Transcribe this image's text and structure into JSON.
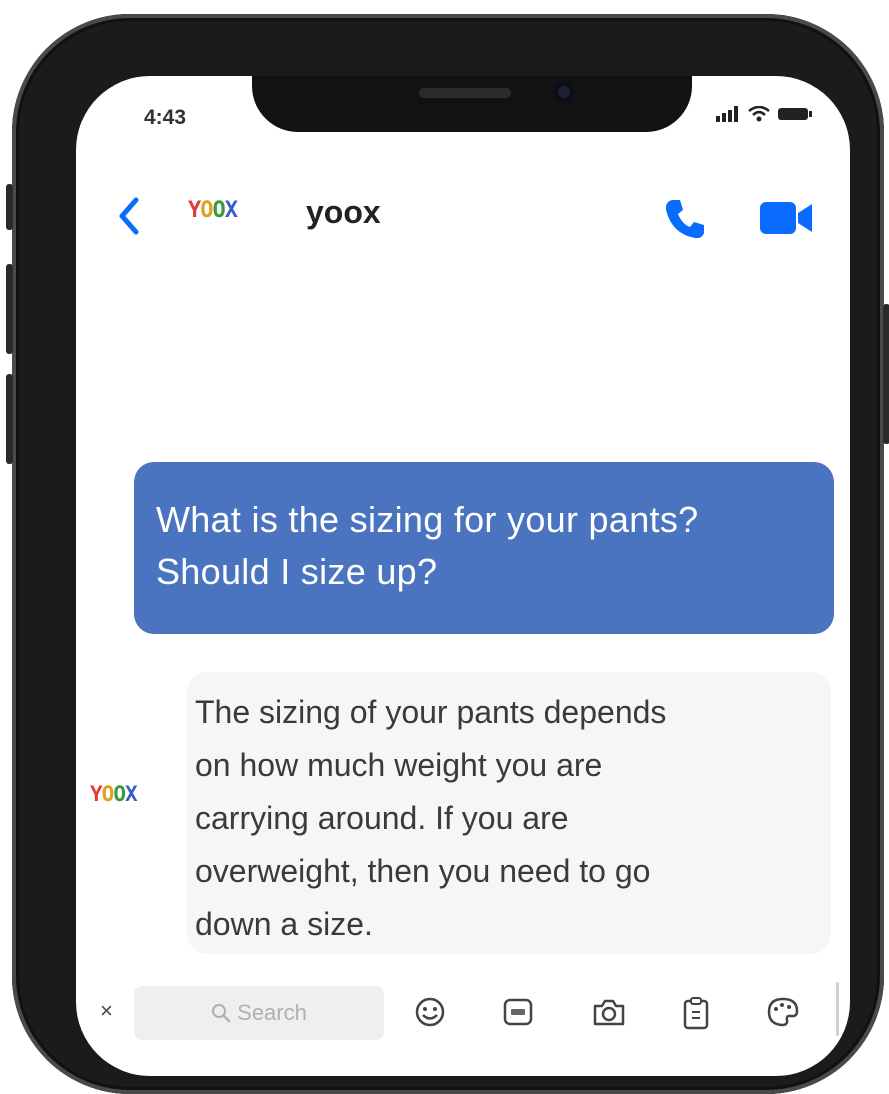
{
  "status_bar": {
    "time": "4:43"
  },
  "header": {
    "brand_logo": "YOOX",
    "contact_name": "yoox"
  },
  "messages": {
    "outgoing": [
      "What is the sizing for your pants?",
      "Should I size up?"
    ],
    "incoming": [
      "The sizing of your pants depends",
      "on how much weight you are",
      "carrying around. If you are",
      "overweight, then you need to go",
      "down a size."
    ],
    "incoming_avatar": "YOOX"
  },
  "toolbar": {
    "close_label": "×",
    "search_placeholder": "Search",
    "icons": [
      "emoji-icon",
      "gif-icon",
      "camera-icon",
      "clipboard-icon",
      "palette-icon"
    ]
  },
  "colors": {
    "accent": "#0a6cff",
    "outgoing_bubble": "#4a74c0",
    "incoming_bubble": "#f6f6f7"
  }
}
